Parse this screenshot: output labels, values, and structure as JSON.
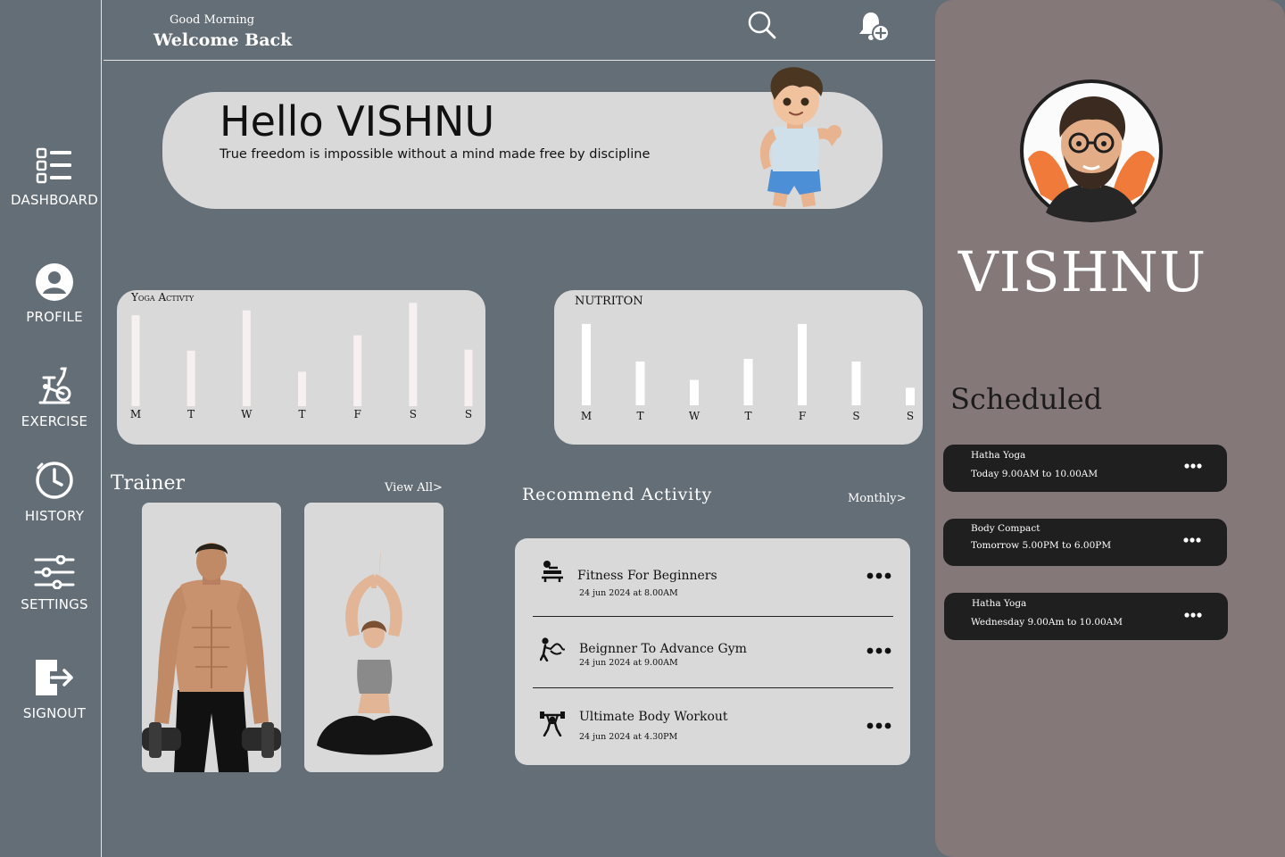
{
  "sidebar": {
    "items": [
      {
        "label": "DASHBOARD",
        "icon": "list-icon"
      },
      {
        "label": "PROFILE",
        "icon": "user-icon"
      },
      {
        "label": "EXERCISE",
        "icon": "exercise-bike-icon"
      },
      {
        "label": "HISTORY",
        "icon": "clock-icon"
      },
      {
        "label": "SETTINGS",
        "icon": "sliders-icon"
      },
      {
        "label": "SIGNOUT",
        "icon": "signout-icon"
      }
    ]
  },
  "header": {
    "greeting": "Good Morning",
    "welcome": "Welcome Back",
    "icons": [
      "search-icon",
      "bell-add-icon"
    ]
  },
  "hello": {
    "title": "Hello VISHNU",
    "quote": "True freedom is impossible without a mind made free by discipline"
  },
  "chart_data": [
    {
      "type": "bar",
      "title": "Yoga Activty",
      "categories": [
        "M",
        "T",
        "W",
        "T",
        "F",
        "S",
        "S"
      ],
      "values": [
        95,
        58,
        100,
        36,
        74,
        108,
        59
      ],
      "ylim": [
        0,
        110
      ],
      "grid": false,
      "legend": "none"
    },
    {
      "type": "bar",
      "title": "NUTRITON",
      "categories": [
        "M",
        "T",
        "W",
        "T",
        "F",
        "S",
        "S"
      ],
      "values": [
        93,
        50,
        29,
        53,
        93,
        50,
        20
      ],
      "ylim": [
        0,
        100
      ],
      "grid": false,
      "legend": "none"
    }
  ],
  "trainer": {
    "title": "Trainer",
    "view_all": "View All>",
    "cards": [
      "trainer-bodybuilder",
      "trainer-yoga"
    ]
  },
  "recommend": {
    "title": "Recommend Activity",
    "filter": "Monthly>",
    "items": [
      {
        "name": "Fitness For Beginners",
        "date": "24 jun 2024 at 8.00AM",
        "icon": "bench-press-icon"
      },
      {
        "name": "Beignner To Advance Gym",
        "date": "24 jun 2024 at 9.00AM",
        "icon": "battle-rope-icon"
      },
      {
        "name": "Ultimate Body Workout",
        "date": "24 jun 2024 at 4.30PM",
        "icon": "weightlifter-icon"
      }
    ]
  },
  "profile": {
    "name": "VISHNU"
  },
  "scheduled": {
    "title": "Scheduled",
    "items": [
      {
        "name": "Hatha Yoga",
        "time": "Today 9.00AM to 10.00AM"
      },
      {
        "name": "Body Compact",
        "time": "Tomorrow 5.00PM to 6.00PM"
      },
      {
        "name": "Hatha Yoga",
        "time": "Wednesday 9.00Am to 10.00AM"
      }
    ]
  },
  "colors": {
    "background": "#636e77",
    "card": "#d9d9d9",
    "right_panel": "#857878",
    "schedule_card": "#1f1f1f"
  }
}
